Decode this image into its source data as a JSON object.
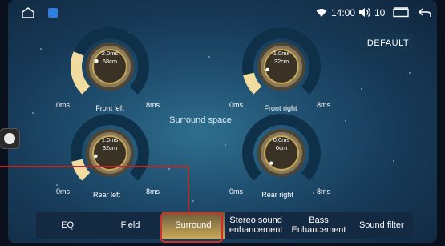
{
  "status_bar": {
    "time": "14:00",
    "volume": "10",
    "icons": [
      "home-icon",
      "app-icon",
      "wifi-icon",
      "volume-icon",
      "window-icon",
      "back-icon"
    ]
  },
  "default_button": "DEFAULT",
  "center_label": "Surround space",
  "knobs": [
    {
      "name": "Front left",
      "min": "0ms",
      "max": "8ms",
      "line1": "2.0ms",
      "line2": "68cm",
      "level": 0.25
    },
    {
      "name": "Front right",
      "min": "0ms",
      "max": "8ms",
      "line1": "1.0ms",
      "line2": "32cm",
      "level": 0.12
    },
    {
      "name": "Rear left",
      "min": "0ms",
      "max": "8ms",
      "line1": "1.0ms",
      "line2": "32cm",
      "level": 0.12
    },
    {
      "name": "Rear right",
      "min": "0ms",
      "max": "8ms",
      "line1": "0.0ms",
      "line2": "0cm",
      "level": 0.0
    }
  ],
  "tabs": [
    {
      "label": "EQ",
      "active": false
    },
    {
      "label": "Field",
      "active": false
    },
    {
      "label": "Surround",
      "active": true
    },
    {
      "label": "Stereo sound enhancement",
      "active": false
    },
    {
      "label": "Bass Enhancement",
      "active": false
    },
    {
      "label": "Sound filter",
      "active": false
    }
  ],
  "colors": {
    "accent_gold": "#c9a95a",
    "ring_dark": "#0f3049",
    "ring_fill": "#f1dca0",
    "highlight_red": "#d0302a"
  }
}
